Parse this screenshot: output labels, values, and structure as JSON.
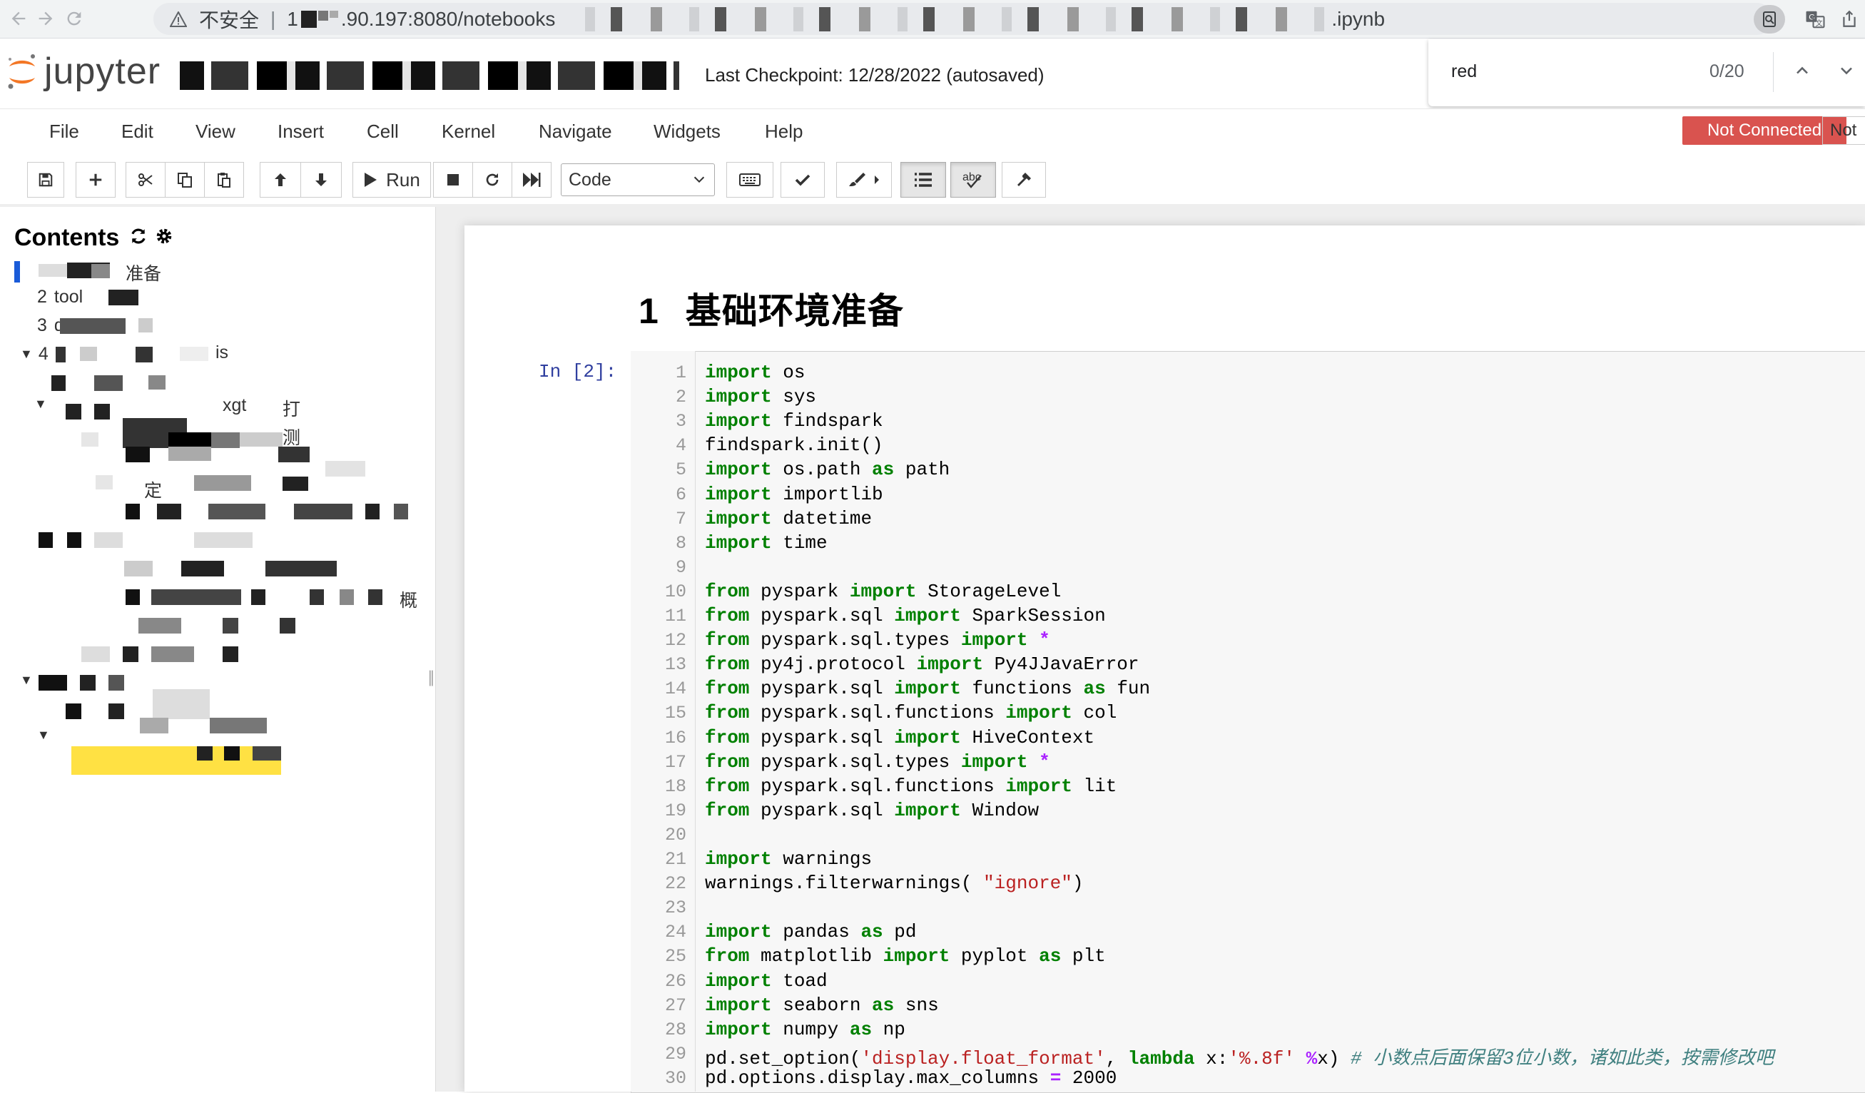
{
  "browser": {
    "insecure_label": "不安全",
    "url_prefix": "1",
    "url_host": ".90.197:8080/notebooks",
    "url_suffix": ".ipynb"
  },
  "find": {
    "query": "red",
    "count": "0/20"
  },
  "header": {
    "logo_text": "jupyter",
    "checkpoint": "Last Checkpoint: 12/28/2022  (autosaved)"
  },
  "menu": {
    "items": [
      "File",
      "Edit",
      "View",
      "Insert",
      "Cell",
      "Kernel",
      "Navigate",
      "Widgets",
      "Help"
    ]
  },
  "status": {
    "kernel": "Not Connected",
    "notification": "Not"
  },
  "toolbar": {
    "run_label": "Run",
    "cell_type": "Code"
  },
  "toc": {
    "title": "Contents",
    "items": [
      {
        "num": "",
        "text": "准备"
      },
      {
        "num": "2",
        "text": "tool"
      },
      {
        "num": "3",
        "text": "d"
      },
      {
        "num": "4",
        "text": "is"
      }
    ],
    "fragments": [
      "xgt",
      "打",
      "测",
      "定",
      "概"
    ]
  },
  "notebook": {
    "heading_num": "1",
    "heading_text": "基础环境准备",
    "prompt": "In [2]:",
    "colors": {
      "keyword": "#008000",
      "string": "#ba2121",
      "operator": "#aa22ff",
      "comment": "#408080"
    },
    "lines": [
      [
        [
          "kw",
          "import"
        ],
        [
          "",
          "os"
        ]
      ],
      [
        [
          "kw",
          "import"
        ],
        [
          "",
          "sys"
        ]
      ],
      [
        [
          "kw",
          "import"
        ],
        [
          "",
          "findspark"
        ]
      ],
      [
        [
          "",
          "findspark.init()"
        ]
      ],
      [
        [
          "kw",
          "import"
        ],
        [
          "",
          "os.path"
        ],
        [
          "kw",
          "as"
        ],
        [
          "",
          "path"
        ]
      ],
      [
        [
          "kw",
          "import"
        ],
        [
          "",
          "importlib"
        ]
      ],
      [
        [
          "kw",
          "import"
        ],
        [
          "",
          "datetime"
        ]
      ],
      [
        [
          "kw",
          "import"
        ],
        [
          "",
          "time"
        ]
      ],
      [],
      [
        [
          "kw",
          "from"
        ],
        [
          "",
          "pyspark"
        ],
        [
          "kw",
          "import"
        ],
        [
          "",
          "StorageLevel"
        ]
      ],
      [
        [
          "kw",
          "from"
        ],
        [
          "",
          "pyspark.sql"
        ],
        [
          "kw",
          "import"
        ],
        [
          "",
          "SparkSession"
        ]
      ],
      [
        [
          "kw",
          "from"
        ],
        [
          "",
          "pyspark.sql.types"
        ],
        [
          "kw",
          "import"
        ],
        [
          "op",
          "*"
        ]
      ],
      [
        [
          "kw",
          "from"
        ],
        [
          "",
          "py4j.protocol"
        ],
        [
          "kw",
          "import"
        ],
        [
          "",
          "Py4JJavaError"
        ]
      ],
      [
        [
          "kw",
          "from"
        ],
        [
          "",
          "pyspark.sql"
        ],
        [
          "kw",
          "import"
        ],
        [
          "",
          "functions"
        ],
        [
          "kw",
          "as"
        ],
        [
          "",
          "fun"
        ]
      ],
      [
        [
          "kw",
          "from"
        ],
        [
          "",
          "pyspark.sql.functions"
        ],
        [
          "kw",
          "import"
        ],
        [
          "",
          "col"
        ]
      ],
      [
        [
          "kw",
          "from"
        ],
        [
          "",
          "pyspark.sql"
        ],
        [
          "kw",
          "import"
        ],
        [
          "",
          "HiveContext"
        ]
      ],
      [
        [
          "kw",
          "from"
        ],
        [
          "",
          "pyspark.sql.types"
        ],
        [
          "kw",
          "import"
        ],
        [
          "op",
          "*"
        ]
      ],
      [
        [
          "kw",
          "from"
        ],
        [
          "",
          "pyspark.sql.functions"
        ],
        [
          "kw",
          "import"
        ],
        [
          "",
          "lit"
        ]
      ],
      [
        [
          "kw",
          "from"
        ],
        [
          "",
          "pyspark.sql"
        ],
        [
          "kw",
          "import"
        ],
        [
          "",
          "Window"
        ]
      ],
      [],
      [
        [
          "kw",
          "import"
        ],
        [
          "",
          "warnings"
        ]
      ],
      [
        [
          "",
          "warnings.filterwarnings("
        ],
        [
          "st",
          "\"ignore\""
        ],
        [
          "nj",
          ")"
        ]
      ],
      [],
      [
        [
          "kw",
          "import"
        ],
        [
          "",
          "pandas"
        ],
        [
          "kw",
          "as"
        ],
        [
          "",
          "pd"
        ]
      ],
      [
        [
          "kw",
          "from"
        ],
        [
          "",
          "matplotlib"
        ],
        [
          "kw",
          "import"
        ],
        [
          "",
          "pyplot"
        ],
        [
          "kw",
          "as"
        ],
        [
          "",
          "plt"
        ]
      ],
      [
        [
          "kw",
          "import"
        ],
        [
          "",
          "toad"
        ]
      ],
      [
        [
          "kw",
          "import"
        ],
        [
          "",
          "seaborn"
        ],
        [
          "kw",
          "as"
        ],
        [
          "",
          "sns"
        ]
      ],
      [
        [
          "kw",
          "import"
        ],
        [
          "",
          "numpy"
        ],
        [
          "kw",
          "as"
        ],
        [
          "",
          "np"
        ]
      ],
      [
        [
          "nj",
          "pd.set_option("
        ],
        [
          "st",
          "'display.float_format'"
        ],
        [
          "nj",
          ", "
        ],
        [
          "kw",
          "lambda"
        ],
        [
          "nj",
          " x:"
        ],
        [
          "st",
          "'%.8f'"
        ],
        [
          "op",
          "%"
        ],
        [
          "nj",
          "x) "
        ],
        [
          "cm",
          "# 小数点后面保留3位小数，诸如此类，按需修改吧"
        ]
      ],
      [
        [
          "nj",
          "pd.options.display.max_columns "
        ],
        [
          "op",
          "="
        ],
        [
          "nj",
          " 2000"
        ]
      ]
    ]
  }
}
